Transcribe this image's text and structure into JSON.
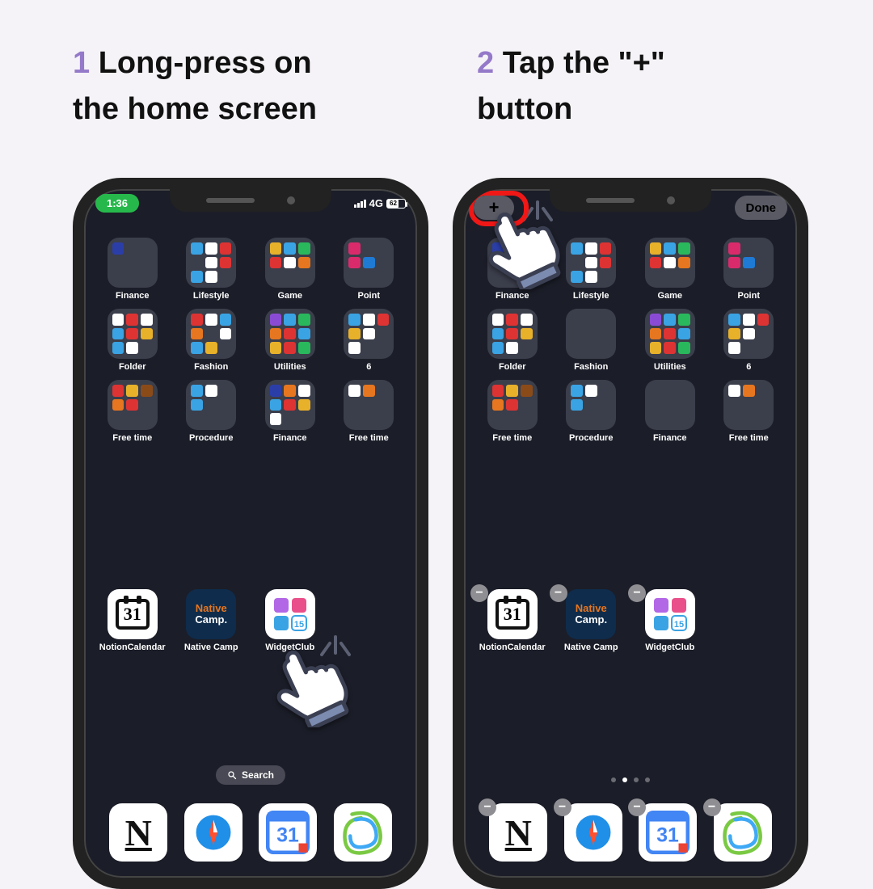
{
  "step1": {
    "num": "1",
    "text_a": " Long-press on",
    "text_b": "the home screen"
  },
  "step2": {
    "num": "2",
    "text_a": " Tap the \"+\"",
    "text_b": "button"
  },
  "status": {
    "time": "1:36",
    "net": "4G",
    "battery_pct": "62"
  },
  "edit": {
    "plus": "+",
    "done": "Done"
  },
  "folders_row1": [
    "Finance",
    "Lifestyle",
    "Game",
    "Point"
  ],
  "folders_row2": [
    "Folder",
    "Fashion",
    "Utilities",
    "6"
  ],
  "folders_row3": [
    "Free time",
    "Procedure",
    "Finance",
    "Free time"
  ],
  "apps": {
    "ncal": "NotionCalendar",
    "native": "Native Camp",
    "wclub": "WidgetClub"
  },
  "native_label": {
    "t1": "Native",
    "t2": "Camp."
  },
  "calendar_day": "31",
  "wclub_day": "15",
  "search": "Search",
  "minus": "−",
  "folder_colors": {
    "finance1": [
      "#2b3ea8",
      "#111",
      "#111",
      "#111",
      "#111",
      "#111",
      "#111",
      "#111",
      "#111"
    ],
    "lifestyle": [
      "#3aa3e3",
      "#fff",
      "#d33",
      "#111",
      "#fff",
      "#d33",
      "#3aa3e3",
      "#fff",
      "#111"
    ],
    "game": [
      "#e8b12a",
      "#3aa3e3",
      "#2ab85c",
      "#d33",
      "#fff",
      "#e6761f",
      "#111",
      "#111",
      "#111"
    ],
    "point": [
      "#d92b6b",
      "#111",
      "#111",
      "#d92b6b",
      "#1f7ad4",
      "#111",
      "#111",
      "#111",
      "#111"
    ],
    "folder": [
      "#fff",
      "#d33",
      "#fff",
      "#3aa3e3",
      "#d33",
      "#e8b12a",
      "#3aa3e3",
      "#fff",
      "#111"
    ],
    "fashion": [
      "#d33",
      "#fff",
      "#3aa3e3",
      "#e6761f",
      "#111",
      "#fff",
      "#3aa3e3",
      "#e8b12a",
      "#111"
    ],
    "utilities": [
      "#8a4bd4",
      "#3aa3e3",
      "#2ab85c",
      "#e6761f",
      "#d33",
      "#3aa3e3",
      "#e8b12a",
      "#d33",
      "#2ab85c"
    ],
    "six": [
      "#3aa3e3",
      "#fff",
      "#d33",
      "#e8b12a",
      "#fff",
      "#111",
      "#fff",
      "#111",
      "#111"
    ],
    "freetime1": [
      "#d33",
      "#e8b12a",
      "#8a4b19",
      "#e6761f",
      "#d33",
      "#111",
      "#111",
      "#111",
      "#111"
    ],
    "procedure": [
      "#3aa3e3",
      "#fff",
      "#111",
      "#3aa3e3",
      "#111",
      "#111",
      "#111",
      "#111",
      "#111"
    ],
    "finance2": [
      "#2b3ea8",
      "#e6761f",
      "#fff",
      "#3aa3e3",
      "#d33",
      "#e8b12a",
      "#fff",
      "#111",
      "#111"
    ],
    "freetime2": [
      "#fff",
      "#e6761f",
      "#111",
      "#111",
      "#111",
      "#111",
      "#111",
      "#111",
      "#111"
    ]
  }
}
